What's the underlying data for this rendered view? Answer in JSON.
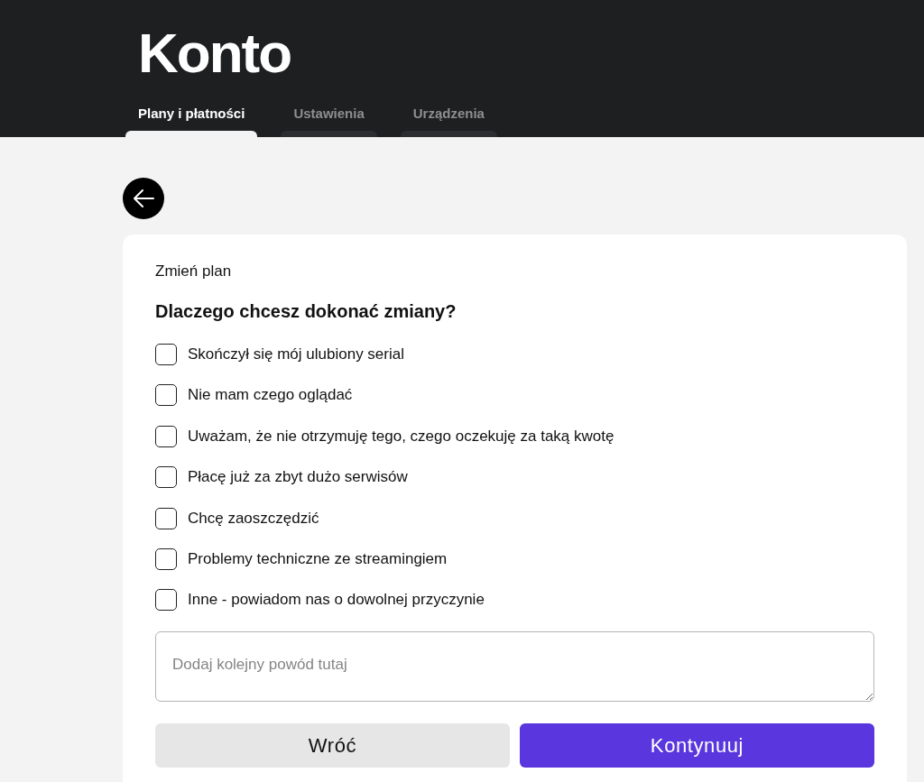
{
  "header": {
    "title": "Konto",
    "tabs": [
      {
        "label": "Plany i płatności",
        "selected": true
      },
      {
        "label": "Ustawienia",
        "selected": false
      },
      {
        "label": "Urządzenia",
        "selected": false
      }
    ]
  },
  "form": {
    "subtitle": "Zmień plan",
    "question": "Dlaczego chcesz dokonać zmiany?",
    "reasons": [
      {
        "label": "Skończył się mój ulubiony serial",
        "checked": false
      },
      {
        "label": "Nie mam czego oglądać",
        "checked": false
      },
      {
        "label": "Uważam, że nie otrzymuję tego, czego oczekuję za taką kwotę",
        "checked": false
      },
      {
        "label": "Płacę już za zbyt dużo serwisów",
        "checked": false
      },
      {
        "label": "Chcę zaoszczędzić",
        "checked": false
      },
      {
        "label": "Problemy techniczne ze streamingiem",
        "checked": false
      },
      {
        "label": "Inne - powiadom nas o dowolnej przyczynie",
        "checked": false
      }
    ],
    "comment": {
      "placeholder": "Dodaj kolejny powód tutaj"
    },
    "buttons": [
      {
        "label": "Wróć",
        "kind": "secondary"
      },
      {
        "label": "Kontynuuj",
        "kind": "primary"
      }
    ]
  }
}
